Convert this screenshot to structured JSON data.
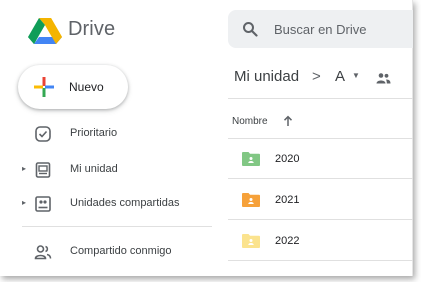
{
  "app": {
    "name": "Drive"
  },
  "search": {
    "placeholder": "Buscar en Drive"
  },
  "new_button": {
    "label": "Nuevo"
  },
  "sidebar": {
    "items": [
      {
        "label": "Prioritario",
        "icon": "priority-check-icon",
        "expandable": false
      },
      {
        "label": "Mi unidad",
        "icon": "my-drive-icon",
        "expandable": true
      },
      {
        "label": "Unidades compartidas",
        "icon": "shared-drives-icon",
        "expandable": true
      },
      {
        "label": "Compartido conmigo",
        "icon": "shared-with-me-icon",
        "expandable": false
      }
    ]
  },
  "breadcrumb": {
    "root": "Mi unidad",
    "separator": ">",
    "current": "A"
  },
  "list": {
    "column_name": "Nombre",
    "sort": "ascending",
    "folders": [
      {
        "name": "2020",
        "color": "#81c784"
      },
      {
        "name": "2021",
        "color": "#f6a13a"
      },
      {
        "name": "2022",
        "color": "#fbe38e"
      }
    ]
  },
  "colors": {
    "drive_blue": "#4285f4",
    "drive_green": "#0f9d58",
    "drive_yellow": "#f4b400",
    "drive_red": "#db4437",
    "search_bg": "#eef0f2"
  }
}
